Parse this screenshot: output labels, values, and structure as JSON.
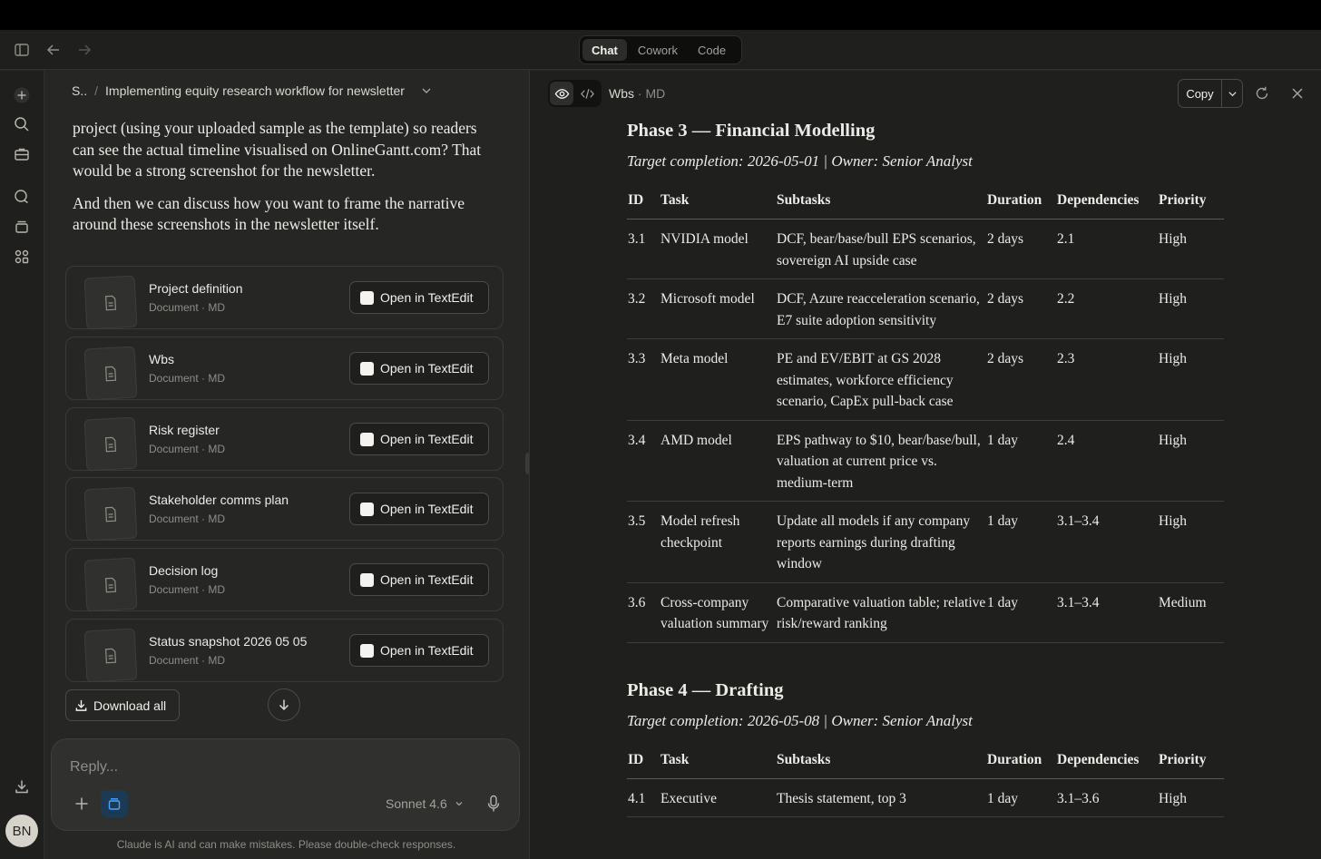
{
  "titlebar": {
    "tabs": [
      {
        "label": "Chat",
        "active": true
      },
      {
        "label": "Cowork",
        "active": false
      },
      {
        "label": "Code",
        "active": false
      }
    ]
  },
  "rail": {
    "avatar_initials": "BN"
  },
  "chat": {
    "breadcrumb": {
      "project": "S..",
      "separator": "/",
      "title": "Implementing equity research workflow for newsletter"
    },
    "message": {
      "p1": "project (using your uploaded sample as the template) so readers can see the actual timeline visualised on OnlineGantt.com? That would be a strong screenshot for the newsletter.",
      "p2": "And then we can discuss how you want to frame the narrative around these screenshots in the newsletter itself."
    },
    "files": [
      {
        "name": "Project definition",
        "meta": "Document · MD",
        "action": "Open in TextEdit"
      },
      {
        "name": "Wbs",
        "meta": "Document · MD",
        "action": "Open in TextEdit"
      },
      {
        "name": "Risk register",
        "meta": "Document · MD",
        "action": "Open in TextEdit"
      },
      {
        "name": "Stakeholder comms plan",
        "meta": "Document · MD",
        "action": "Open in TextEdit"
      },
      {
        "name": "Decision log",
        "meta": "Document · MD",
        "action": "Open in TextEdit"
      },
      {
        "name": "Status snapshot 2026 05 05",
        "meta": "Document · MD",
        "action": "Open in TextEdit"
      }
    ],
    "download_all": "Download all",
    "composer": {
      "placeholder": "Reply...",
      "model": "Sonnet 4.6"
    },
    "disclaimer": "Claude is AI and can make mistakes. Please double-check responses."
  },
  "panel": {
    "doc_name": "Wbs",
    "doc_meta": " · MD",
    "copy_label": "Copy",
    "table_headers": [
      "ID",
      "Task",
      "Subtasks",
      "Duration",
      "Dependencies",
      "Priority"
    ],
    "phases": [
      {
        "title": "Phase 3 — Financial Modelling",
        "target": "Target completion: 2026-05-01 | Owner: Senior Analyst",
        "rows": [
          {
            "id": "3.1",
            "task": "NVIDIA model",
            "subtasks": "DCF, bear/base/bull EPS scenarios, sovereign AI upside case",
            "duration": "2 days",
            "deps": "2.1",
            "priority": "High"
          },
          {
            "id": "3.2",
            "task": "Microsoft model",
            "subtasks": "DCF, Azure reacceleration scenario, E7 suite adoption sensitivity",
            "duration": "2 days",
            "deps": "2.2",
            "priority": "High"
          },
          {
            "id": "3.3",
            "task": "Meta model",
            "subtasks": "PE and EV/EBIT at GS 2028 estimates, workforce efficiency scenario, CapEx pull-back case",
            "duration": "2 days",
            "deps": "2.3",
            "priority": "High"
          },
          {
            "id": "3.4",
            "task": "AMD model",
            "subtasks": "EPS pathway to $10, bear/base/bull, valuation at current price vs. medium-term",
            "duration": "1 day",
            "deps": "2.4",
            "priority": "High"
          },
          {
            "id": "3.5",
            "task": "Model refresh checkpoint",
            "subtasks": "Update all models if any company reports earnings during drafting window",
            "duration": "1 day",
            "deps": "3.1–3.4",
            "priority": "High"
          },
          {
            "id": "3.6",
            "task": "Cross-company valuation summary",
            "subtasks": "Comparative valuation table; relative risk/reward ranking",
            "duration": "1 day",
            "deps": "3.1–3.4",
            "priority": "Medium"
          }
        ]
      },
      {
        "title": "Phase 4 — Drafting",
        "target": "Target completion: 2026-05-08 | Owner: Senior Analyst",
        "rows": [
          {
            "id": "4.1",
            "task": "Executive",
            "subtasks": "Thesis statement, top 3",
            "duration": "1 day",
            "deps": "3.1–3.6",
            "priority": "High"
          }
        ]
      }
    ]
  }
}
